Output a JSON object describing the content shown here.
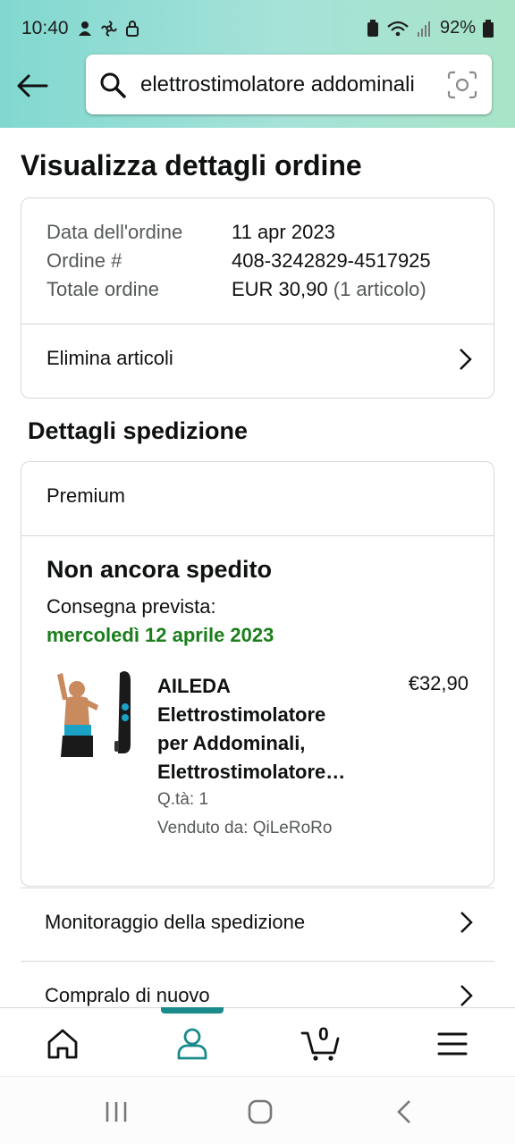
{
  "status_bar": {
    "time": "10:40",
    "battery": "92%"
  },
  "search": {
    "query": "elettrostimolatore addominali"
  },
  "page": {
    "title": "Visualizza dettagli ordine"
  },
  "order_summary": {
    "date_label": "Data dell'ordine",
    "date_value": "11 apr 2023",
    "number_label": "Ordine #",
    "number_value": "408-3242829-4517925",
    "total_label": "Totale ordine",
    "total_value": "EUR 30,90",
    "total_items": "(1 articolo)",
    "remove_items_label": "Elimina articoli"
  },
  "shipping": {
    "section_title": "Dettagli spedizione",
    "type": "Premium",
    "status": "Non ancora spedito",
    "delivery_label": "Consegna prevista:",
    "delivery_date": "mercoledì 12 aprile 2023",
    "product": {
      "name_line1": "AILEDA",
      "name_line2": "Elettrostimolatore",
      "name_line3": "per Addominali,",
      "name_line4": "Elettrostimolatore…",
      "price": "€32,90",
      "qty": "Q.tà: 1",
      "seller": "Venduto da: QiLeRoRo"
    }
  },
  "actions": {
    "track_label": "Monitoraggio della spedizione",
    "buy_again_label": "Compralo di nuovo"
  },
  "bottom_nav": {
    "cart_count": "0"
  },
  "colors": {
    "accent": "#1b8a8a",
    "delivery_green": "#1b7e1b",
    "header_gradient_start": "#81d8d0"
  }
}
